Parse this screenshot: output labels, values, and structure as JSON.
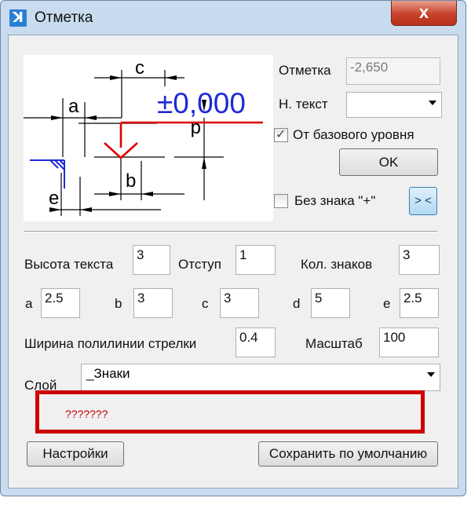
{
  "window": {
    "title": "Отметка",
    "close_label": "x"
  },
  "preview": {
    "mark_text": "±0,000",
    "dim_labels": {
      "a": "a",
      "b": "b",
      "c": "c",
      "d": "d",
      "e": "e"
    }
  },
  "mark_field": {
    "label": "Отметка",
    "value": "-2,650"
  },
  "start_text": {
    "label": "Н. текст",
    "value": ""
  },
  "from_base": {
    "label": "От базового уровня",
    "checked": true
  },
  "ok_button": "OK",
  "no_plus": {
    "label": "Без знака \"+\"",
    "checked": false
  },
  "swap_button": "> <",
  "params": {
    "text_height": {
      "label": "Высота текста",
      "value": "3"
    },
    "offset": {
      "label": "Отступ",
      "value": "1"
    },
    "num_digits": {
      "label": "Кол. знаков",
      "value": "3"
    },
    "a": {
      "label": "a",
      "value": "2.5"
    },
    "b": {
      "label": "b",
      "value": "3"
    },
    "c": {
      "label": "c",
      "value": "3"
    },
    "d": {
      "label": "d",
      "value": "5"
    },
    "e": {
      "label": "e",
      "value": "2.5"
    },
    "arrow_width": {
      "label": "Ширина полилинии стрелки",
      "value": "0.4"
    },
    "scale": {
      "label": "Масштаб",
      "value": "100"
    }
  },
  "layer": {
    "label": "Слой",
    "value": "_Знаки"
  },
  "message": {
    "text": "???????",
    "color": "#c00000",
    "frame_color": "#cc0000"
  },
  "buttons": {
    "settings": "Настройки",
    "save_default": "Сохранить по умолчанию"
  },
  "colors": {
    "accent_blue": "#1f2ad6",
    "mark_red": "#e00000",
    "ground_blue": "#1f2ad6"
  }
}
